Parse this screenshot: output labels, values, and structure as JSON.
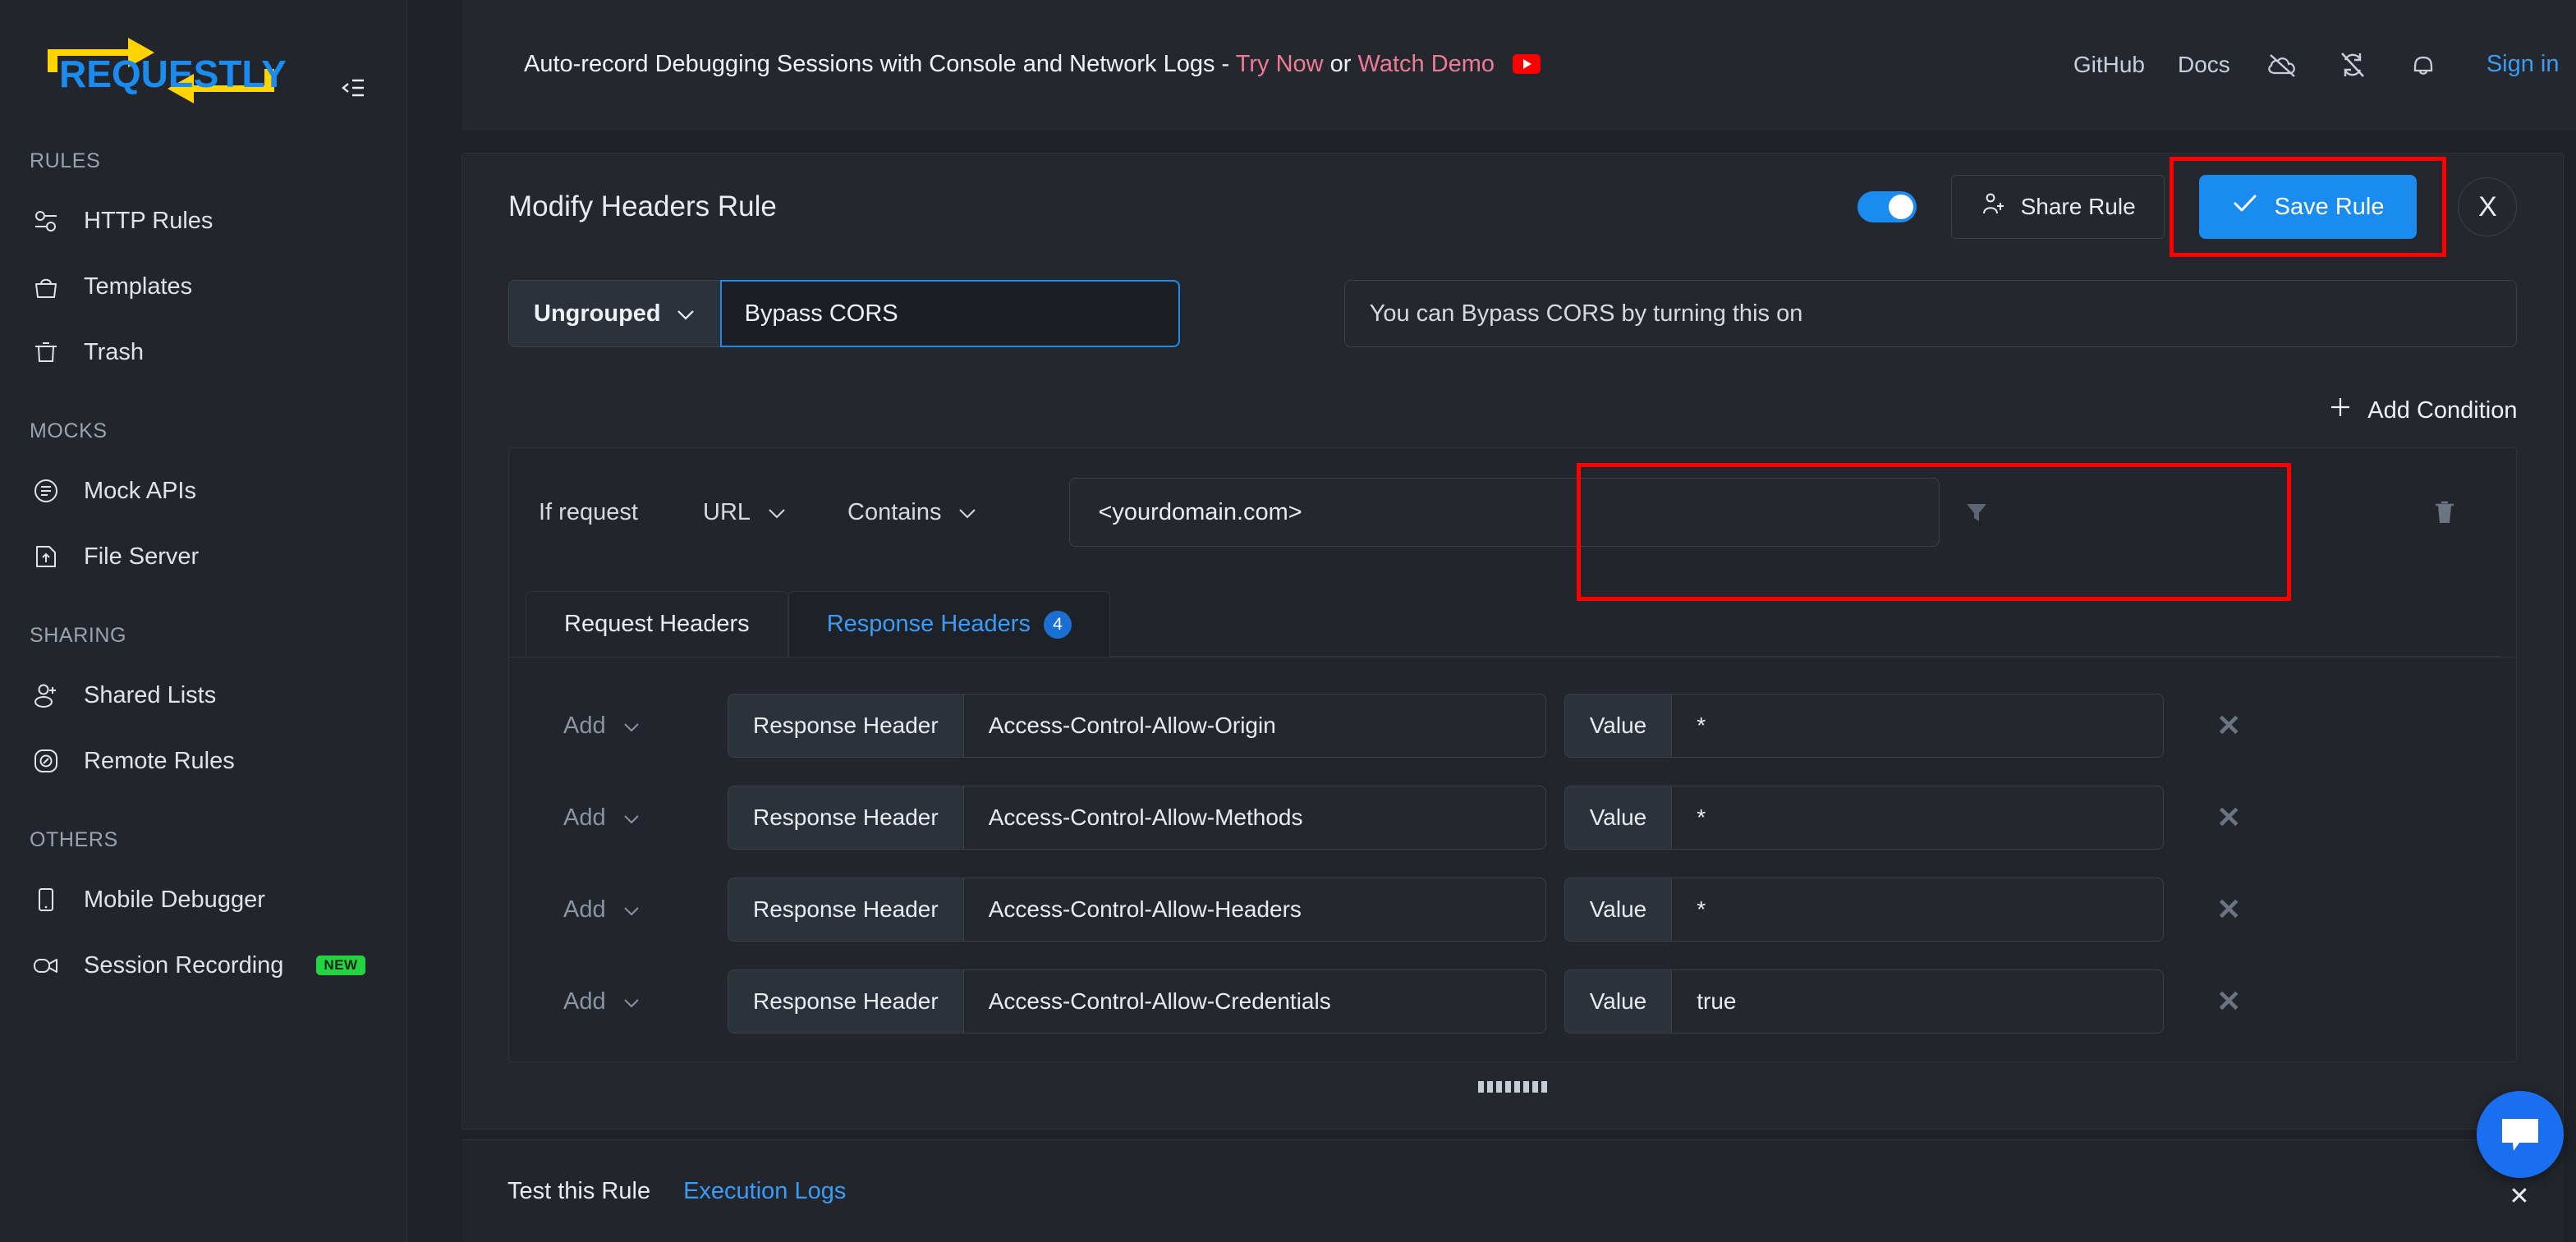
{
  "sidebar": {
    "logo_text": "REQUESTLY",
    "sections": [
      {
        "title": "RULES",
        "items": [
          {
            "label": "HTTP Rules",
            "icon": "sliders-icon"
          },
          {
            "label": "Templates",
            "icon": "bag-icon"
          },
          {
            "label": "Trash",
            "icon": "trash-icon"
          }
        ]
      },
      {
        "title": "MOCKS",
        "items": [
          {
            "label": "Mock APIs",
            "icon": "list-circle-icon"
          },
          {
            "label": "File Server",
            "icon": "file-upload-icon"
          }
        ]
      },
      {
        "title": "SHARING",
        "items": [
          {
            "label": "Shared Lists",
            "icon": "user-plus-icon"
          },
          {
            "label": "Remote Rules",
            "icon": "compass-icon"
          }
        ]
      },
      {
        "title": "OTHERS",
        "items": [
          {
            "label": "Mobile Debugger",
            "icon": "mobile-icon"
          },
          {
            "label": "Session Recording",
            "icon": "video-camera-icon",
            "badge": "NEW"
          }
        ]
      }
    ]
  },
  "topbar": {
    "banner_prefix": "Auto-record Debugging Sessions with Console and Network Logs -",
    "banner_link_1": "Try Now",
    "banner_or": "or",
    "banner_link_2": "Watch Demo",
    "github": "GitHub",
    "docs": "Docs",
    "signin": "Sign in"
  },
  "rule": {
    "title": "Modify Headers Rule",
    "share_label": "Share Rule",
    "save_label": "Save Rule",
    "close_label": "X",
    "group": "Ungrouped",
    "name_value": "Bypass CORS",
    "description_value": "You can Bypass CORS by turning this on",
    "add_condition_label": "Add Condition",
    "condition": {
      "if_label": "If request",
      "source": "URL",
      "operator": "Contains",
      "value": "<yourdomain.com>"
    },
    "tabs": [
      {
        "label": "Request Headers",
        "active": false
      },
      {
        "label": "Response Headers",
        "active": true,
        "badge": "4"
      }
    ],
    "header_rows": [
      {
        "action": "Add",
        "type_label": "Response Header",
        "name": "Access-Control-Allow-Origin",
        "value_label": "Value",
        "value": "*"
      },
      {
        "action": "Add",
        "type_label": "Response Header",
        "name": "Access-Control-Allow-Methods",
        "value_label": "Value",
        "value": "*"
      },
      {
        "action": "Add",
        "type_label": "Response Header",
        "name": "Access-Control-Allow-Headers",
        "value_label": "Value",
        "value": "*"
      },
      {
        "action": "Add",
        "type_label": "Response Header",
        "name": "Access-Control-Allow-Credentials",
        "value_label": "Value",
        "value": "true"
      }
    ]
  },
  "bottom": {
    "test_tab": "Test this Rule",
    "logs_tab": "Execution Logs"
  },
  "colors": {
    "accent_blue": "#1a8cf0",
    "link_blue": "#3b9cf5",
    "highlight_red": "#ff0000",
    "badge_green": "#22d642",
    "logo_yellow": "#ffd400"
  }
}
